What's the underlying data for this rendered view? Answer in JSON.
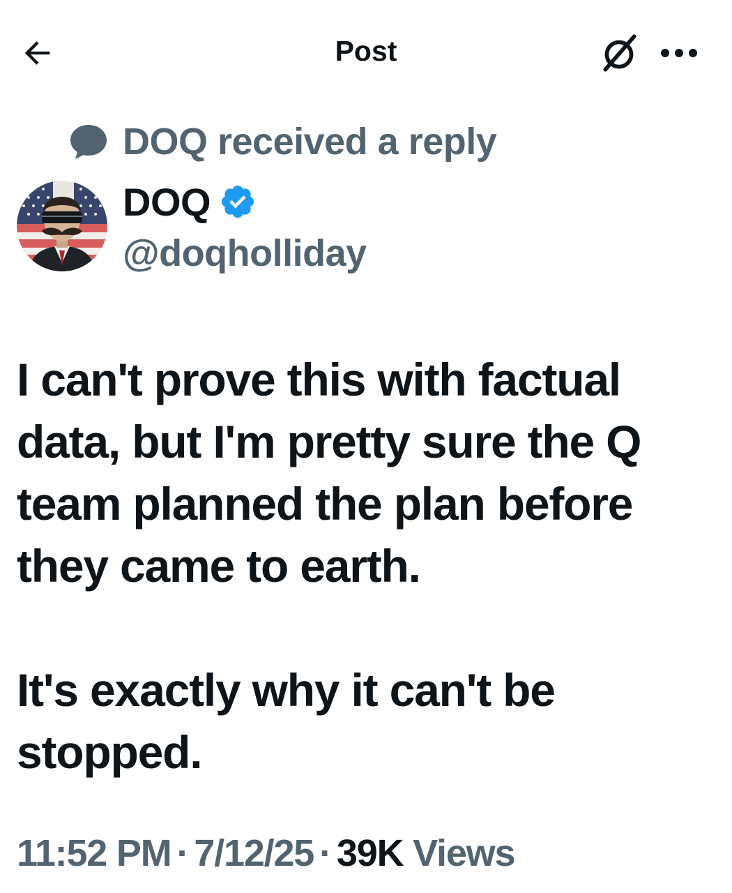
{
  "header": {
    "title": "Post",
    "back_icon": "arrow-left-icon",
    "grok_icon": "grok-icon",
    "more_icon": "more-horizontal-icon"
  },
  "social_context": {
    "icon": "speech-bubble-icon",
    "text": "DOQ received a reply"
  },
  "author": {
    "display_name": "DOQ",
    "handle": "@doqholliday",
    "verified": true,
    "verified_color": "#1d9bf0"
  },
  "post": {
    "paragraphs": [
      "I can't prove this with factual data, but I'm pretty sure the Q team planned the plan before they came to earth.",
      "It's exactly why it can't be stopped."
    ]
  },
  "meta": {
    "time": "11:52 PM",
    "separator": "·",
    "date": "7/12/25",
    "views_count": "39K",
    "views_label": "Views"
  },
  "colors": {
    "primary_text": "#0f1419",
    "secondary_text": "#536471",
    "accent": "#1d9bf0"
  }
}
